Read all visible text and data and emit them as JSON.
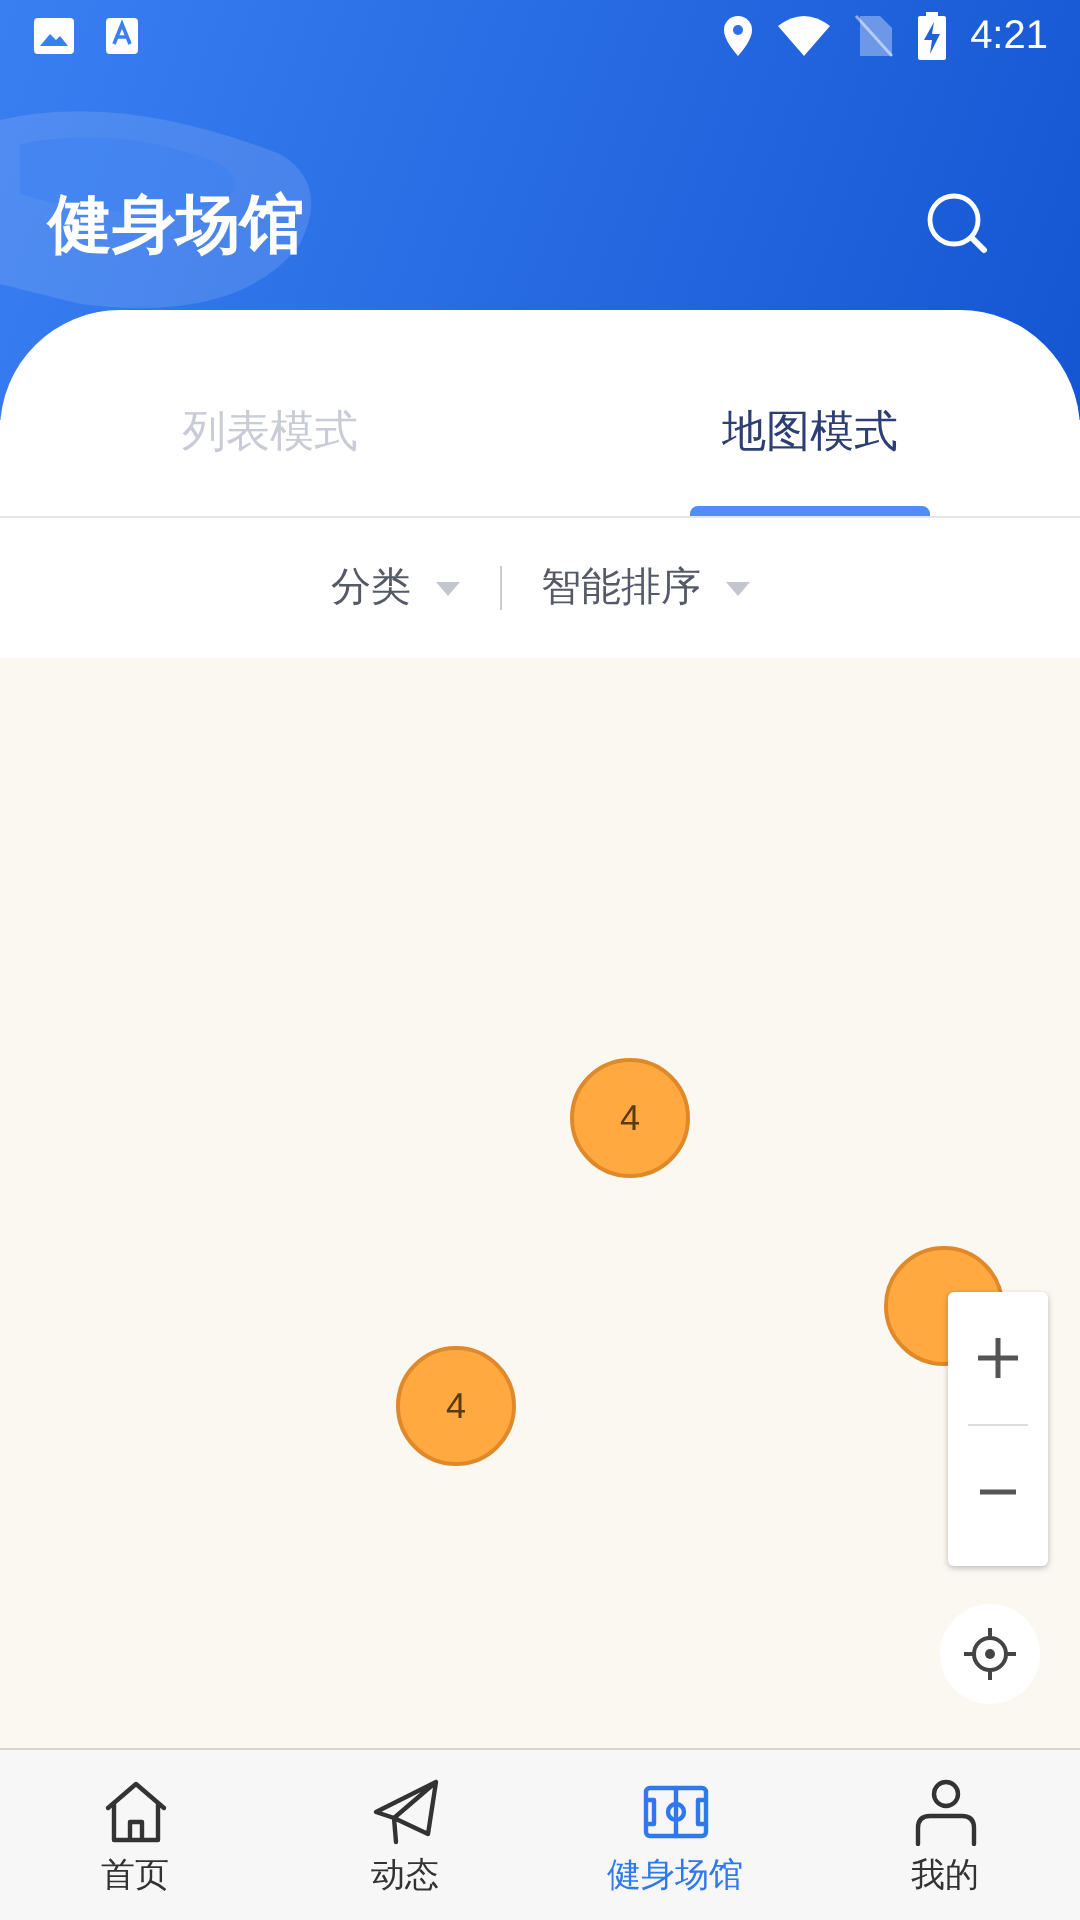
{
  "status_bar": {
    "time": "4:21"
  },
  "header": {
    "title": "健身场馆"
  },
  "tabs": [
    {
      "label": "列表模式",
      "selected": false
    },
    {
      "label": "地图模式",
      "selected": true
    }
  ],
  "filters": [
    {
      "label": "分类"
    },
    {
      "label": "智能排序"
    }
  ],
  "map": {
    "markers": [
      {
        "kind": "cluster",
        "count": "4"
      },
      {
        "kind": "cluster",
        "count": "4"
      },
      {
        "kind": "cluster"
      }
    ]
  },
  "bottom_nav": [
    {
      "label": "首页",
      "kind": "home",
      "selected": false
    },
    {
      "label": "动态",
      "kind": "plane",
      "selected": false
    },
    {
      "label": "健身场馆",
      "kind": "field",
      "selected": true
    },
    {
      "label": "我的",
      "kind": "person",
      "selected": false
    }
  ]
}
